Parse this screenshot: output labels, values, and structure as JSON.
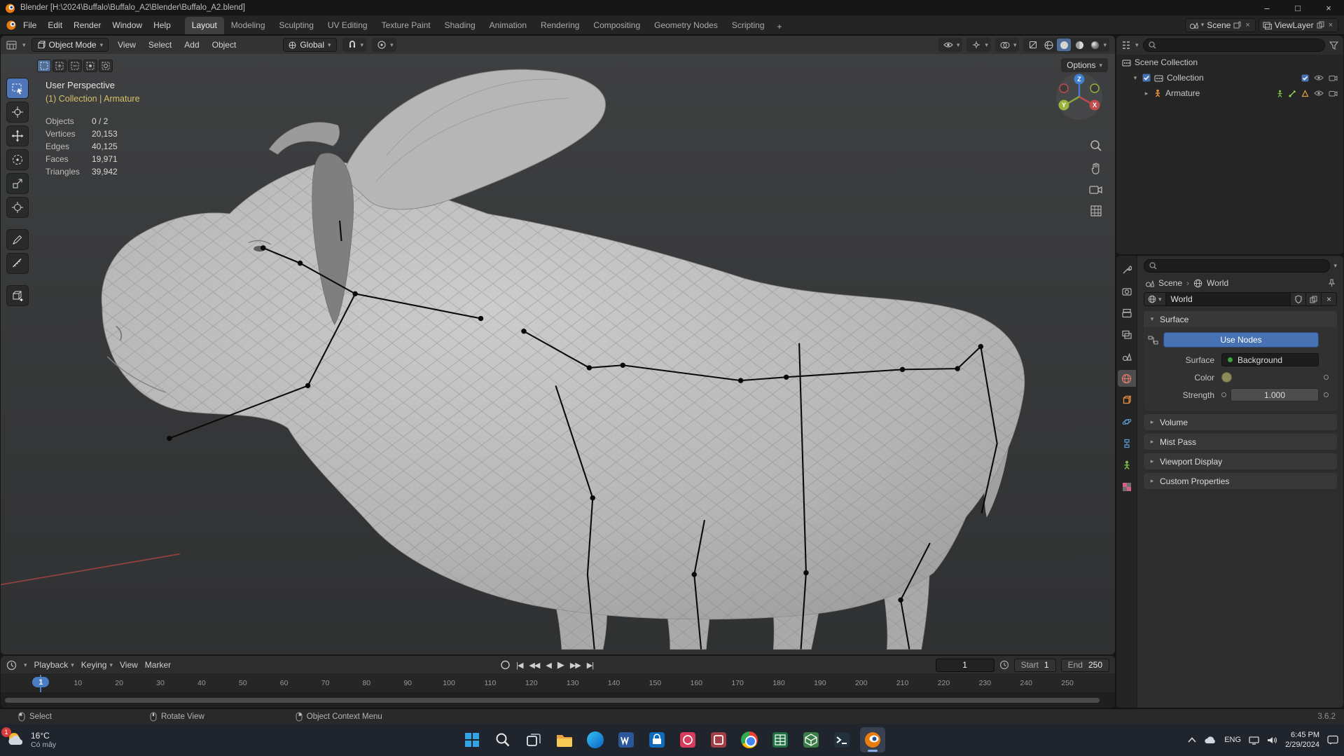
{
  "title_bar": {
    "app_title": "Blender [H:\\2024\\Buffalo\\Buffalo_A2\\Blender\\Buffalo_A2.blend]"
  },
  "top_bar": {
    "menus": [
      "File",
      "Edit",
      "Render",
      "Window",
      "Help"
    ],
    "workspaces": [
      "Layout",
      "Modeling",
      "Sculpting",
      "UV Editing",
      "Texture Paint",
      "Shading",
      "Animation",
      "Rendering",
      "Compositing",
      "Geometry Nodes",
      "Scripting"
    ],
    "active_workspace": "Layout",
    "add_workspace_label": "+",
    "scene_name": "Scene",
    "view_layer_name": "ViewLayer"
  },
  "viewport": {
    "header": {
      "mode": "Object Mode",
      "menus": [
        "View",
        "Select",
        "Add",
        "Object"
      ],
      "orientation": "Global",
      "options_label": "Options"
    },
    "overlay": {
      "perspective": "User Perspective",
      "context": "(1) Collection | Armature",
      "stats": [
        {
          "label": "Objects",
          "value": "0 / 2"
        },
        {
          "label": "Vertices",
          "value": "20,153"
        },
        {
          "label": "Edges",
          "value": "40,125"
        },
        {
          "label": "Faces",
          "value": "19,971"
        },
        {
          "label": "Triangles",
          "value": "39,942"
        }
      ]
    },
    "gizmo_axes": {
      "x": "X",
      "y": "Y",
      "z": "Z"
    }
  },
  "outliner": {
    "rows": [
      {
        "label": "Scene Collection"
      },
      {
        "label": "Collection"
      },
      {
        "label": "Armature"
      }
    ]
  },
  "properties": {
    "tabs": [
      "tool",
      "render",
      "output",
      "view-layer",
      "scene",
      "world",
      "object",
      "physics",
      "constraints",
      "object-data",
      "texture"
    ],
    "active_tab": "world",
    "breadcrumb": {
      "scene": "Scene",
      "world": "World"
    },
    "world_name": "World",
    "surface": {
      "section": "Surface",
      "use_nodes": "Use Nodes",
      "surface_label": "Surface",
      "surface_value": "Background",
      "color_label": "Color",
      "strength_label": "Strength",
      "strength_value": "1.000"
    },
    "collapsed_sections": [
      "Volume",
      "Mist Pass",
      "Viewport Display",
      "Custom Properties"
    ]
  },
  "timeline": {
    "menus": [
      "Playback",
      "Keying",
      "View",
      "Marker"
    ],
    "current_frame": "1",
    "start_label": "Start",
    "start_value": "1",
    "end_label": "End",
    "end_value": "250",
    "ticks": [
      "1",
      "10",
      "20",
      "30",
      "40",
      "50",
      "60",
      "70",
      "80",
      "90",
      "100",
      "110",
      "120",
      "130",
      "140",
      "150",
      "160",
      "170",
      "180",
      "190",
      "200",
      "210",
      "220",
      "230",
      "240",
      "250"
    ]
  },
  "status_bar": {
    "hints": [
      "Select",
      "Rotate View",
      "Object Context Menu"
    ],
    "version": "3.6.2"
  },
  "taskbar": {
    "weather_temp": "16°C",
    "weather_desc": "Có mây",
    "weather_badge": "1",
    "apps": [
      "start",
      "search",
      "task-view",
      "file-explorer",
      "edge",
      "word",
      "store",
      "photos",
      "office",
      "chrome",
      "excel",
      "green-app",
      "terminal",
      "blender"
    ],
    "tray": {
      "language": "ENG",
      "time": "6:45 PM",
      "date": "2/29/2024"
    }
  }
}
